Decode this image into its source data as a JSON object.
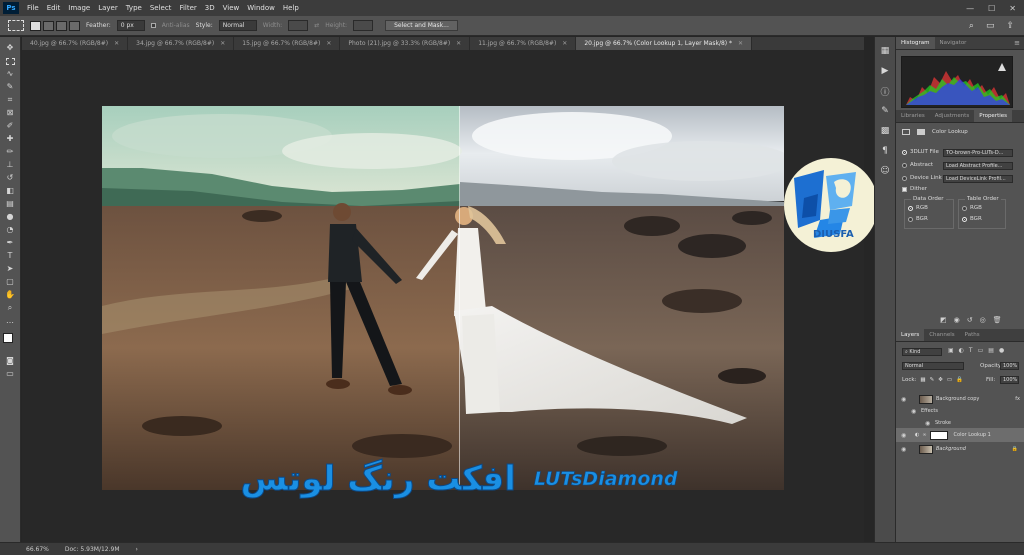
{
  "menubar": {
    "logo": "Ps",
    "items": [
      "File",
      "Edit",
      "Image",
      "Layer",
      "Type",
      "Select",
      "Filter",
      "3D",
      "View",
      "Window",
      "Help"
    ],
    "window_controls": [
      "—",
      "☐",
      "✕"
    ]
  },
  "options": {
    "feather_label": "Feather:",
    "feather_value": "0 px",
    "antialias_label": "Anti-alias",
    "style_label": "Style:",
    "style_value": "Normal",
    "width_label": "Width:",
    "height_label": "Height:",
    "select_mask_button": "Select and Mask..."
  },
  "tabs": [
    {
      "label": "40.jpg @ 66.7% (RGB/8#)",
      "close": "✕"
    },
    {
      "label": "34.jpg @ 66.7% (RGB/8#)",
      "close": "✕"
    },
    {
      "label": "15.jpg @ 66.7% (RGB/8#)",
      "close": "✕"
    },
    {
      "label": "Photo (21).jpg @ 33.3% (RGB/8#)",
      "close": "✕"
    },
    {
      "label": "11.jpg @ 66.7% (RGB/8#)",
      "close": "✕"
    },
    {
      "label": "20.jpg @ 66.7% (Color Lookup 1, Layer Mask/8) *",
      "close": "✕"
    }
  ],
  "canvas": {
    "brand_fa": "افکت رنگ لوتس",
    "brand_en": "LUTsDiamond",
    "logo_text": "DIUSFA"
  },
  "status": {
    "zoom": "66.67%",
    "doc": "Doc: 5.93M/12.9M",
    "arrow": "›"
  },
  "panels": {
    "histogram_tabs": [
      "Histogram",
      "Navigator"
    ],
    "props_tabs": [
      "Libraries",
      "Adjustments",
      "Properties"
    ],
    "props_title": "Color Lookup",
    "lut_file_label": "3DLUT File",
    "lut_file_value": "TO-brown-Pro-LUTs-D...",
    "abstract_label": "Abstract",
    "abstract_value": "Load Abstract Profile...",
    "device_link_label": "Device Link",
    "device_link_value": "Load DeviceLink Profil...",
    "dither_label": "Dither",
    "data_order_label": "Data Order",
    "table_order_label": "Table Order",
    "rgb_label": "RGB",
    "bgr_label": "BGR",
    "layers_tabs": [
      "Layers",
      "Channels",
      "Paths"
    ],
    "kind_label": "Kind",
    "blend_mode": "Normal",
    "opacity_label": "Opacity:",
    "opacity_value": "100%",
    "lock_label": "Lock:",
    "fill_label": "Fill:",
    "fill_value": "100%",
    "layers": [
      {
        "name": "Background copy",
        "fx": "fx"
      },
      {
        "name": "Effects"
      },
      {
        "name": "Stroke"
      },
      {
        "name": "Color Lookup 1"
      },
      {
        "name": "Background"
      }
    ]
  }
}
